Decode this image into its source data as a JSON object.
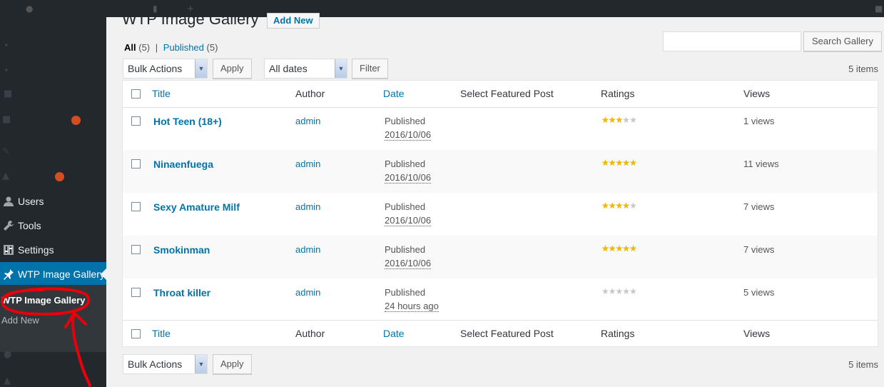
{
  "page": {
    "title": "WTP Image Gallery",
    "add_new_label": "Add New"
  },
  "sidebar": {
    "items": [
      {
        "label": "Users",
        "icon": "users-icon"
      },
      {
        "label": "Tools",
        "icon": "wrench-icon"
      },
      {
        "label": "Settings",
        "icon": "settings-icon"
      },
      {
        "label": "WTP Image Gallery",
        "icon": "pin-icon"
      }
    ],
    "submenu": [
      {
        "label": "WTP Image Gallery"
      },
      {
        "label": "Add New"
      }
    ]
  },
  "filters": {
    "all_label": "All",
    "all_count": "(5)",
    "published_label": "Published",
    "published_count": "(5)",
    "separator": "|"
  },
  "search": {
    "button_label": "Search Gallery",
    "value": ""
  },
  "toolbar_top": {
    "bulk_actions": "Bulk Actions",
    "apply_label": "Apply",
    "dates": "All dates",
    "filter_label": "Filter",
    "items_count": "5 items"
  },
  "toolbar_bottom": {
    "bulk_actions": "Bulk Actions",
    "apply_label": "Apply",
    "items_count": "5 items"
  },
  "table": {
    "columns": {
      "title": "Title",
      "author": "Author",
      "date": "Date",
      "featured": "Select Featured Post",
      "ratings": "Ratings",
      "views": "Views"
    },
    "rows": [
      {
        "title": "Hot Teen (18+)",
        "author": "admin",
        "status": "Published",
        "date": "2016/10/06",
        "rating": 3,
        "views": "1 views"
      },
      {
        "title": "Ninaenfuega",
        "author": "admin",
        "status": "Published",
        "date": "2016/10/06",
        "rating": 5,
        "views": "11 views"
      },
      {
        "title": "Sexy Amature Milf",
        "author": "admin",
        "status": "Published",
        "date": "2016/10/06",
        "rating": 4,
        "views": "7 views"
      },
      {
        "title": "Smokinman",
        "author": "admin",
        "status": "Published",
        "date": "2016/10/06",
        "rating": 5,
        "views": "7 views"
      },
      {
        "title": "Throat killer",
        "author": "admin",
        "status": "Published",
        "date": "24 hours ago",
        "rating": 0,
        "views": "5 views"
      }
    ]
  },
  "colors": {
    "accent": "#0073aa",
    "sidebar_bg": "#23282d",
    "star_on": "#f0b800",
    "annotation": "#e8000b"
  }
}
